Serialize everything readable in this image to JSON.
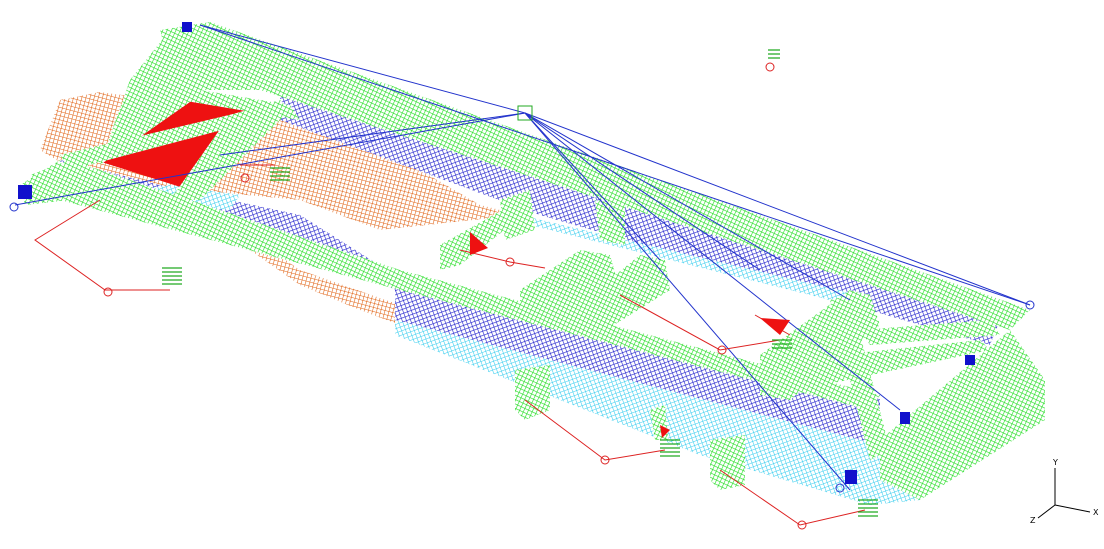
{
  "viewport": {
    "background": "#ffffff",
    "colors": {
      "green_mesh": "#22dd22",
      "blue_mesh": "#2222cc",
      "red_mesh": "#ee1111",
      "orange_mesh": "#e06010",
      "cyan_mesh": "#33ccee",
      "rbe_line": "#2233cc",
      "spring": "#dd2222",
      "spring_coil": "#22aa22"
    },
    "axis_triad": {
      "y": "Y",
      "x": "X",
      "z": "Z"
    }
  }
}
